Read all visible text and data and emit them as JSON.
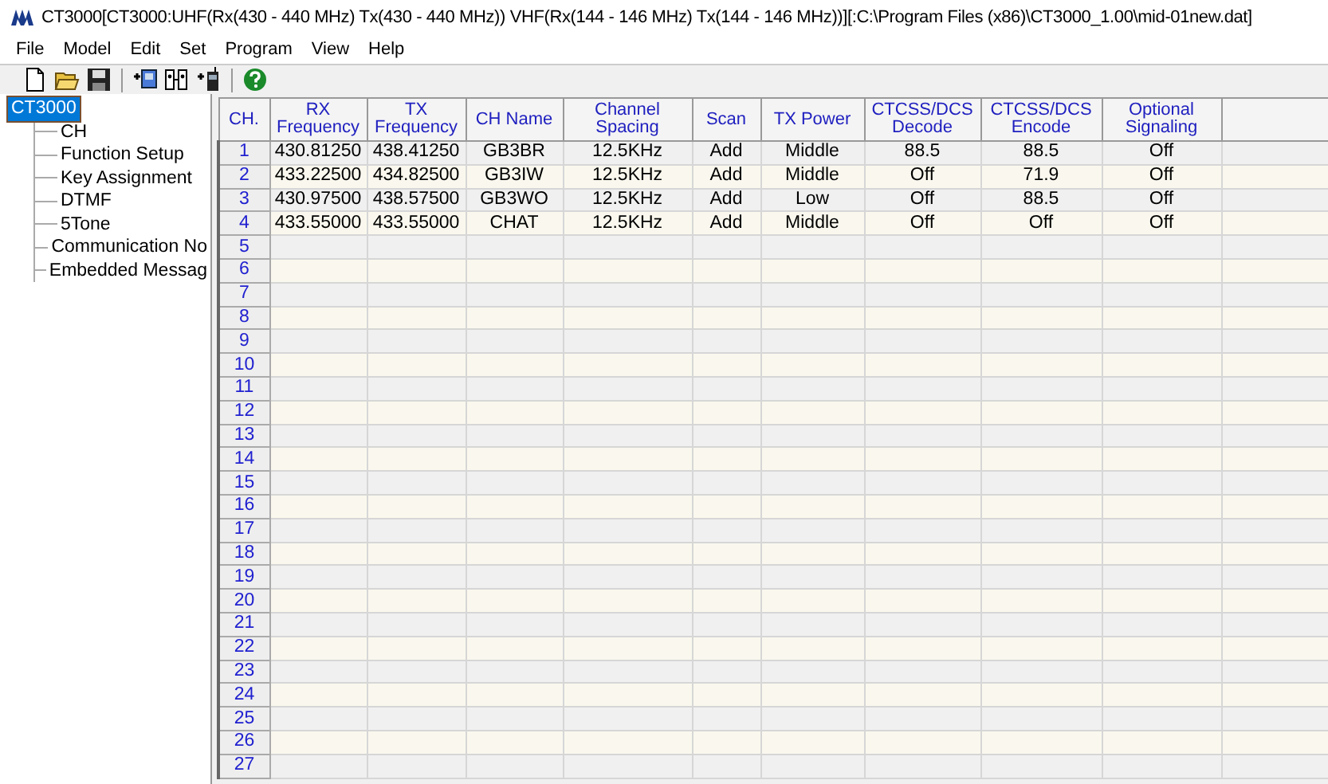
{
  "window": {
    "title": "CT3000[CT3000:UHF(Rx(430 - 440 MHz) Tx(430 - 440 MHz)) VHF(Rx(144 - 146 MHz) Tx(144 - 146 MHz))][:C:\\Program Files (x86)\\CT3000_1.00\\mid-01new.dat]"
  },
  "menu": [
    "File",
    "Model",
    "Edit",
    "Set",
    "Program",
    "View",
    "Help"
  ],
  "tree": {
    "label": "CT3000",
    "selected": true,
    "children": [
      {
        "label": "CH",
        "selected": false
      },
      {
        "label": "Function Setup",
        "selected": false
      },
      {
        "label": "Key Assignment",
        "selected": false
      },
      {
        "label": "DTMF",
        "selected": false
      },
      {
        "label": "5Tone",
        "selected": false
      },
      {
        "label": "Communication No",
        "selected": false
      },
      {
        "label": "Embedded Messag",
        "selected": false
      }
    ]
  },
  "table": {
    "columns": [
      "CH.",
      "RX Frequency",
      "TX Frequency",
      "CH Name",
      "Channel Spacing",
      "Scan",
      "TX Power",
      "CTCSS/DCS Decode",
      "CTCSS/DCS Encode",
      "Optional Signaling"
    ],
    "rows": [
      {
        "ch": "1",
        "cells": [
          "430.81250",
          "438.41250",
          "GB3BR",
          "12.5KHz",
          "Add",
          "Middle",
          "88.5",
          "88.5",
          "Off"
        ]
      },
      {
        "ch": "2",
        "cells": [
          "433.22500",
          "434.82500",
          "GB3IW",
          "12.5KHz",
          "Add",
          "Middle",
          "Off",
          "71.9",
          "Off"
        ]
      },
      {
        "ch": "3",
        "cells": [
          "430.97500",
          "438.57500",
          "GB3WO",
          "12.5KHz",
          "Add",
          "Low",
          "Off",
          "88.5",
          "Off"
        ]
      },
      {
        "ch": "4",
        "cells": [
          "433.55000",
          "433.55000",
          "CHAT",
          "12.5KHz",
          "Add",
          "Middle",
          "Off",
          "Off",
          "Off"
        ]
      },
      {
        "ch": "5"
      },
      {
        "ch": "6"
      },
      {
        "ch": "7"
      },
      {
        "ch": "8"
      },
      {
        "ch": "9"
      },
      {
        "ch": "10"
      },
      {
        "ch": "11"
      },
      {
        "ch": "12"
      },
      {
        "ch": "13"
      },
      {
        "ch": "14"
      },
      {
        "ch": "15"
      },
      {
        "ch": "16"
      },
      {
        "ch": "17"
      },
      {
        "ch": "18"
      },
      {
        "ch": "19"
      },
      {
        "ch": "20"
      },
      {
        "ch": "21"
      },
      {
        "ch": "22"
      },
      {
        "ch": "23"
      },
      {
        "ch": "24"
      },
      {
        "ch": "25"
      },
      {
        "ch": "26"
      },
      {
        "ch": "27"
      }
    ]
  }
}
